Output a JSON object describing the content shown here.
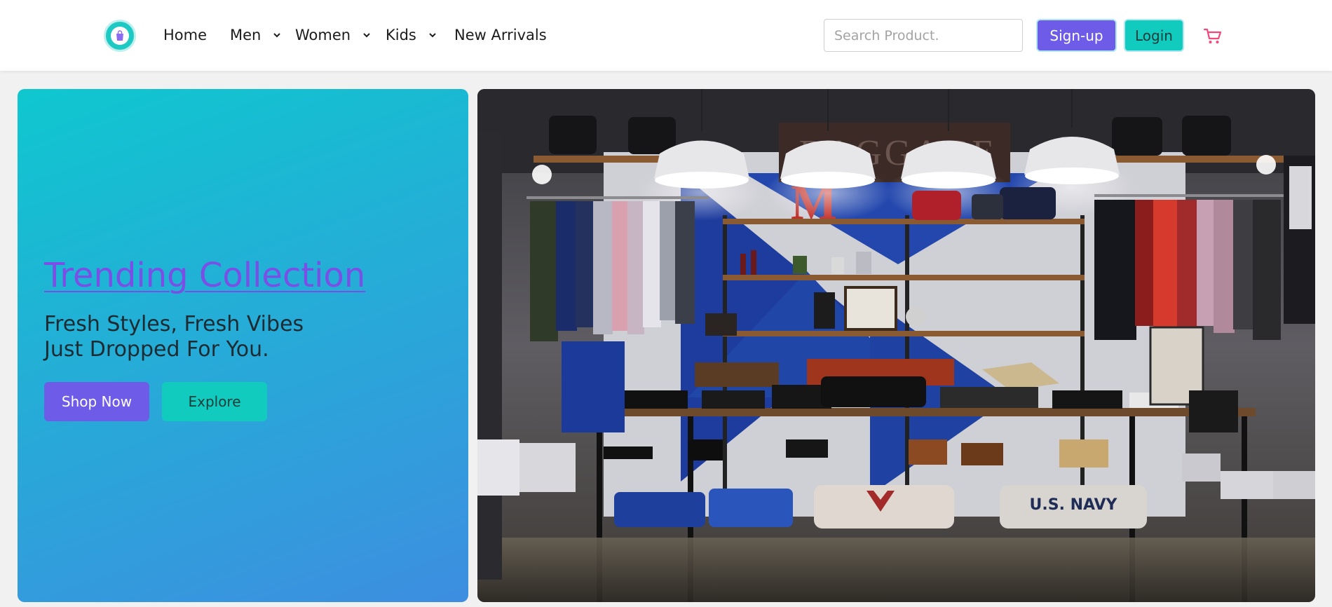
{
  "navbar": {
    "logo_icon": "shopping-bag-icon",
    "links": [
      {
        "label": "Home",
        "has_dropdown": false
      },
      {
        "label": "Men",
        "has_dropdown": true
      },
      {
        "label": "Women",
        "has_dropdown": true
      },
      {
        "label": "Kids",
        "has_dropdown": true
      },
      {
        "label": "New Arrivals",
        "has_dropdown": false
      }
    ],
    "search_placeholder": "Search Product.",
    "signup_label": "Sign-up",
    "login_label": "Login",
    "cart_icon": "cart-icon"
  },
  "hero": {
    "title": "Trending Collection",
    "subtitle_line1": "Fresh Styles, Fresh Vibes",
    "subtitle_line2": "Just Dropped For You.",
    "shop_label": "Shop Now",
    "explore_label": "Explore",
    "image_signs": {
      "baggage": "BAGGAGE",
      "letter": "M",
      "navy_shirt": "U.S. NAVY"
    }
  },
  "colors": {
    "primary": "#6e5ce9",
    "accent": "#11cbbf",
    "cart": "#f0497a",
    "title": "#7a4fe6"
  }
}
